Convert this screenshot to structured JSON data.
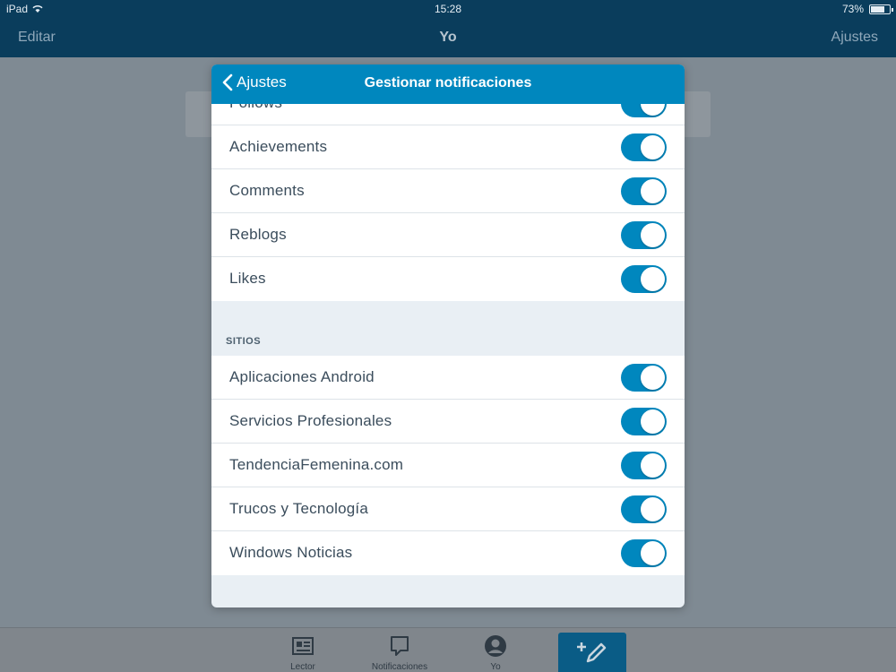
{
  "status_bar": {
    "device": "iPad",
    "time": "15:28",
    "battery": "73%",
    "battery_level": 0.73
  },
  "nav": {
    "left": "Editar",
    "title": "Yo",
    "right": "Ajustes"
  },
  "modal": {
    "back_label": "Ajustes",
    "title": "Gestionar notificaciones",
    "top_items": [
      {
        "label": "Follows",
        "on": true
      },
      {
        "label": "Achievements",
        "on": true
      },
      {
        "label": "Comments",
        "on": true
      },
      {
        "label": "Reblogs",
        "on": true
      },
      {
        "label": "Likes",
        "on": true
      }
    ],
    "sites_header": "SITIOS",
    "sites": [
      {
        "label": "Aplicaciones Android",
        "on": true
      },
      {
        "label": "Servicios Profesionales",
        "on": true
      },
      {
        "label": "TendenciaFemenina.com",
        "on": true
      },
      {
        "label": "Trucos y Tecnología",
        "on": true
      },
      {
        "label": "Windows Noticias",
        "on": true
      }
    ]
  },
  "tabs": [
    {
      "label": "Lector",
      "icon": "reader-icon"
    },
    {
      "label": "Notificaciones",
      "icon": "notifications-icon"
    },
    {
      "label": "Yo",
      "icon": "me-icon"
    }
  ],
  "colors": {
    "accent": "#0087be",
    "nav": "#0a3d5c"
  }
}
